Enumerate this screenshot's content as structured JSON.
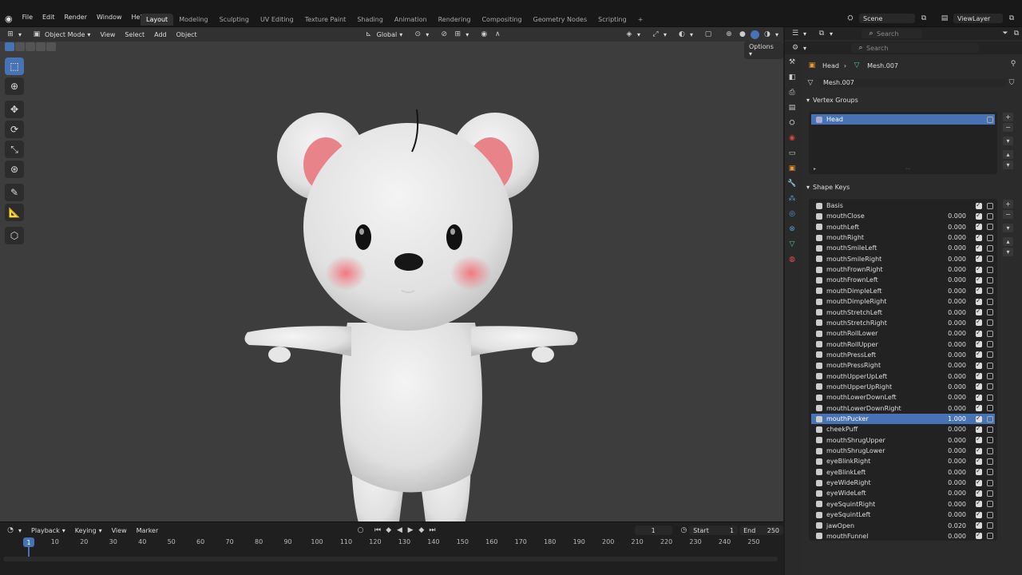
{
  "menus": [
    "File",
    "Edit",
    "Render",
    "Window",
    "Help"
  ],
  "workspaces": [
    "Layout",
    "Modeling",
    "Sculpting",
    "UV Editing",
    "Texture Paint",
    "Shading",
    "Animation",
    "Rendering",
    "Compositing",
    "Geometry Nodes",
    "Scripting"
  ],
  "active_workspace": "Layout",
  "scene": "Scene",
  "view_layer": "ViewLayer",
  "viewport": {
    "mode": "Object Mode",
    "menu": [
      "View",
      "Select",
      "Add",
      "Object"
    ],
    "transform_orientation": "Global",
    "options": "Options"
  },
  "timeline": {
    "menu": [
      "Playback",
      "Keying",
      "View",
      "Marker"
    ],
    "current_frame": "1",
    "start_label": "Start",
    "start": "1",
    "end_label": "End",
    "end": "250",
    "ticks": [
      "10",
      "20",
      "30",
      "40",
      "50",
      "60",
      "70",
      "80",
      "90",
      "100",
      "110",
      "120",
      "130",
      "140",
      "150",
      "160",
      "170",
      "180",
      "190",
      "200",
      "210",
      "220",
      "230",
      "240",
      "250"
    ],
    "cursor": "1"
  },
  "outliner": {
    "search_placeholder": "Search"
  },
  "properties": {
    "search_placeholder": "Search",
    "breadcrumb_object": "Head",
    "breadcrumb_mesh": "Mesh.007",
    "mesh_name": "Mesh.007",
    "vertex_groups_title": "Vertex Groups",
    "vertex_groups": [
      "Head"
    ],
    "shape_keys_title": "Shape Keys",
    "shape_keys": [
      {
        "name": "Basis",
        "value": ""
      },
      {
        "name": "mouthClose",
        "value": "0.000"
      },
      {
        "name": "mouthLeft",
        "value": "0.000"
      },
      {
        "name": "mouthRight",
        "value": "0.000"
      },
      {
        "name": "mouthSmileLeft",
        "value": "0.000"
      },
      {
        "name": "mouthSmileRight",
        "value": "0.000"
      },
      {
        "name": "mouthFrownRight",
        "value": "0.000"
      },
      {
        "name": "mouthFrownLeft",
        "value": "0.000"
      },
      {
        "name": "mouthDimpleLeft",
        "value": "0.000"
      },
      {
        "name": "mouthDimpleRight",
        "value": "0.000"
      },
      {
        "name": "mouthStretchLeft",
        "value": "0.000"
      },
      {
        "name": "mouthStretchRight",
        "value": "0.000"
      },
      {
        "name": "mouthRollLower",
        "value": "0.000"
      },
      {
        "name": "mouthRollUpper",
        "value": "0.000"
      },
      {
        "name": "mouthPressLeft",
        "value": "0.000"
      },
      {
        "name": "mouthPressRight",
        "value": "0.000"
      },
      {
        "name": "mouthUpperUpLeft",
        "value": "0.000"
      },
      {
        "name": "mouthUpperUpRight",
        "value": "0.000"
      },
      {
        "name": "mouthLowerDownLeft",
        "value": "0.000"
      },
      {
        "name": "mouthLowerDownRight",
        "value": "0.000"
      },
      {
        "name": "mouthPucker",
        "value": "1.000"
      },
      {
        "name": "cheekPuff",
        "value": "0.000"
      },
      {
        "name": "mouthShrugUpper",
        "value": "0.000"
      },
      {
        "name": "mouthShrugLower",
        "value": "0.000"
      },
      {
        "name": "eyeBlinkRight",
        "value": "0.000"
      },
      {
        "name": "eyeBlinkLeft",
        "value": "0.000"
      },
      {
        "name": "eyeWideRight",
        "value": "0.000"
      },
      {
        "name": "eyeWideLeft",
        "value": "0.000"
      },
      {
        "name": "eyeSquintRight",
        "value": "0.000"
      },
      {
        "name": "eyeSquintLeft",
        "value": "0.000"
      },
      {
        "name": "jawOpen",
        "value": "0.020"
      },
      {
        "name": "mouthFunnel",
        "value": "0.000"
      }
    ],
    "selected_shape_key": "mouthPucker"
  },
  "colors": {
    "accent": "#4772b3",
    "viewport_bg": "#3d3d3d",
    "panel_bg": "#2b2b2b"
  }
}
